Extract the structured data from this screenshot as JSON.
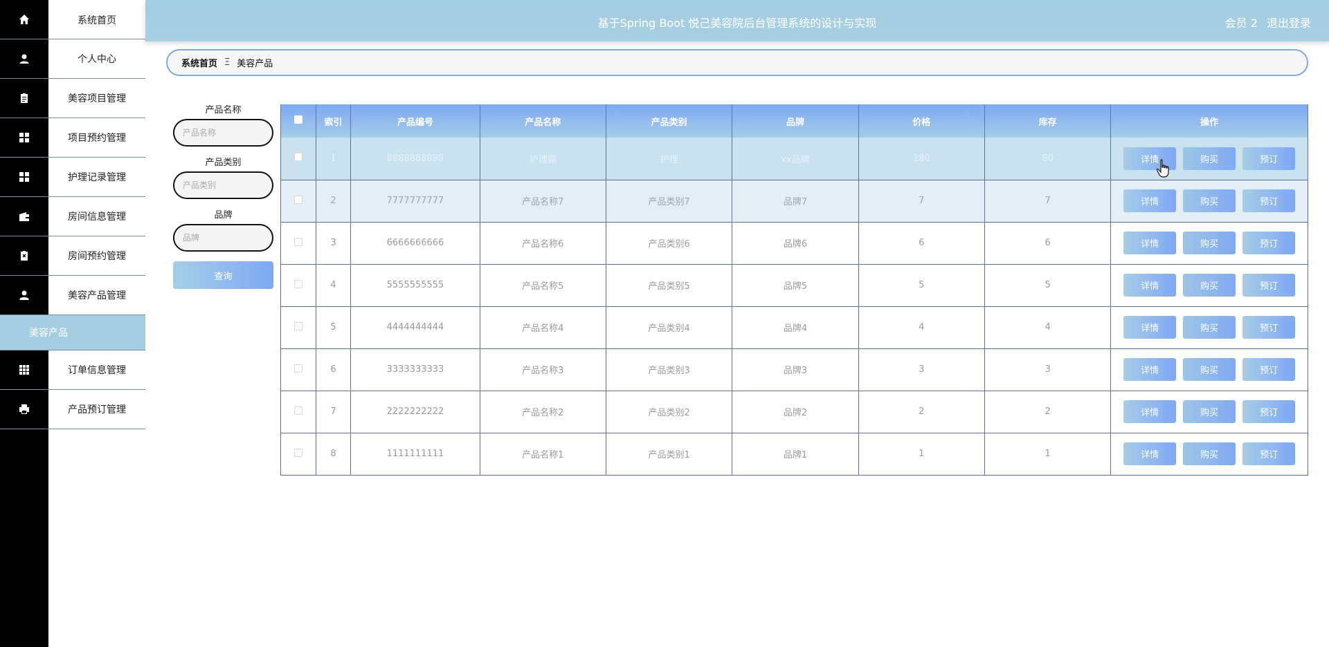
{
  "header": {
    "title": "基于Spring Boot 悦己美容院后台管理系统的设计与实现",
    "user": "会员 2",
    "logout": "退出登录"
  },
  "sidebar": {
    "items": [
      {
        "label": "系统首页",
        "icon": "home-icon"
      },
      {
        "label": "个人中心",
        "icon": "user-icon"
      },
      {
        "label": "美容项目管理",
        "icon": "clipboard-icon"
      },
      {
        "label": "项目预约管理",
        "icon": "grid-icon"
      },
      {
        "label": "护理记录管理",
        "icon": "grid-icon"
      },
      {
        "label": "房间信息管理",
        "icon": "wallet-icon"
      },
      {
        "label": "房间预约管理",
        "icon": "clipboard-x-icon"
      },
      {
        "label": "美容产品管理",
        "icon": "person-icon"
      },
      {
        "label": "订单信息管理",
        "icon": "apps-icon"
      },
      {
        "label": "产品预订管理",
        "icon": "printer-icon"
      }
    ],
    "submenu": "美容产品"
  },
  "breadcrumb": {
    "home": "系统首页",
    "separator": "Ξ",
    "current": "美容产品"
  },
  "search": {
    "name_label": "产品名称",
    "name_placeholder": "产品名称",
    "type_label": "产品类别",
    "type_placeholder": "产品类别",
    "brand_label": "品牌",
    "brand_placeholder": "品牌",
    "button": "查询"
  },
  "table": {
    "headers": [
      "索引",
      "产品编号",
      "产品名称",
      "产品类别",
      "品牌",
      "价格",
      "库存",
      "操作"
    ],
    "rows": [
      {
        "index": "1",
        "code": "8888888888",
        "name": "护理霜",
        "type": "护理",
        "brand": "xx品牌",
        "price": "180",
        "stock": "80"
      },
      {
        "index": "2",
        "code": "7777777777",
        "name": "产品名称7",
        "type": "产品类别7",
        "brand": "品牌7",
        "price": "7",
        "stock": "7"
      },
      {
        "index": "3",
        "code": "6666666666",
        "name": "产品名称6",
        "type": "产品类别6",
        "brand": "品牌6",
        "price": "6",
        "stock": "6"
      },
      {
        "index": "4",
        "code": "5555555555",
        "name": "产品名称5",
        "type": "产品类别5",
        "brand": "品牌5",
        "price": "5",
        "stock": "5"
      },
      {
        "index": "5",
        "code": "4444444444",
        "name": "产品名称4",
        "type": "产品类别4",
        "brand": "品牌4",
        "price": "4",
        "stock": "4"
      },
      {
        "index": "6",
        "code": "3333333333",
        "name": "产品名称3",
        "type": "产品类别3",
        "brand": "品牌3",
        "price": "3",
        "stock": "3"
      },
      {
        "index": "7",
        "code": "2222222222",
        "name": "产品名称2",
        "type": "产品类别2",
        "brand": "品牌2",
        "price": "2",
        "stock": "2"
      },
      {
        "index": "8",
        "code": "1111111111",
        "name": "产品名称1",
        "type": "产品类别1",
        "brand": "品牌1",
        "price": "1",
        "stock": "1"
      }
    ],
    "actions": {
      "detail": "详情",
      "buy": "购买",
      "reserve": "预订"
    }
  }
}
